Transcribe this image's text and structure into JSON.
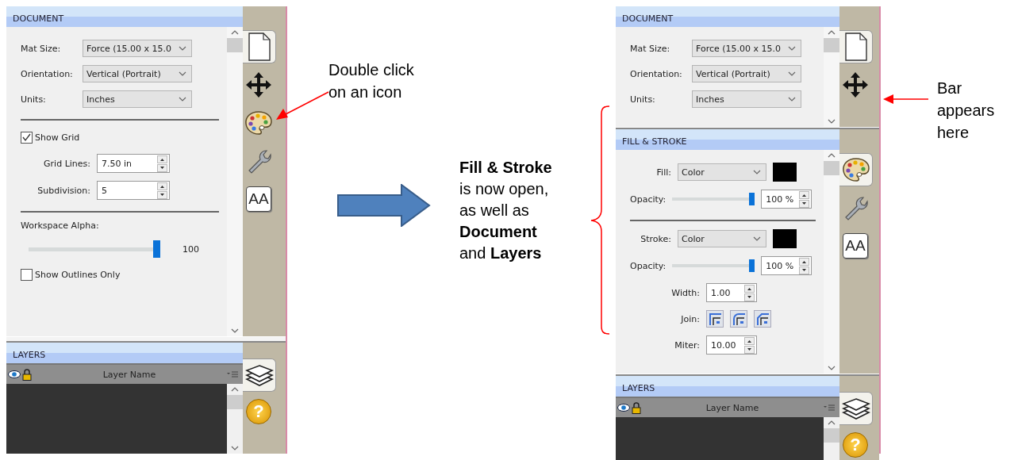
{
  "panels": [
    {
      "sections": [
        {
          "kind": "document",
          "title": "DOCUMENT",
          "tool_tabs": [
            {
              "kind": "document",
              "selected": true
            },
            {
              "kind": "move",
              "selected": false
            },
            {
              "kind": "palette",
              "selected": false
            },
            {
              "kind": "wrench",
              "selected": false
            },
            {
              "kind": "text_size",
              "glyph": "AA",
              "selected": false
            }
          ],
          "groups": [
            [
              {
                "kind": "select",
                "label": "Mat Size:",
                "value": "Force (15.00 x 15.0"
              },
              {
                "kind": "select",
                "label": "Orientation:",
                "value": "Vertical (Portrait)"
              },
              {
                "kind": "select",
                "label": "Units:",
                "value": "Inches"
              }
            ],
            [
              {
                "kind": "check",
                "label": "Show Grid",
                "checked": true
              },
              {
                "kind": "spin",
                "label": "Grid Lines:",
                "value": "7.50 in"
              },
              {
                "kind": "spin",
                "label": "Subdivision:",
                "value": "5"
              }
            ],
            [
              {
                "kind": "slider",
                "label": "Workspace Alpha:",
                "level": 1,
                "reading": "100"
              },
              {
                "kind": "check",
                "label": "Show Outlines Only",
                "checked": false
              }
            ]
          ]
        },
        {
          "kind": "layers",
          "title": "LAYERS",
          "column_header": "Layer Name",
          "tool_tabs": [
            {
              "kind": "layers",
              "selected": true
            },
            {
              "kind": "help",
              "glyph": "?",
              "selected": false
            }
          ]
        }
      ]
    },
    {
      "sections": [
        {
          "kind": "document",
          "title": "DOCUMENT",
          "tool_tabs": [
            {
              "kind": "document",
              "selected": true
            },
            {
              "kind": "move",
              "selected": false
            }
          ],
          "groups": [
            [
              {
                "kind": "select",
                "label": "Mat Size:",
                "value": "Force (15.00 x 15.0"
              },
              {
                "kind": "select",
                "label": "Orientation:",
                "value": "Vertical (Portrait)"
              },
              {
                "kind": "select",
                "label": "Units:",
                "value": "Inches"
              }
            ]
          ]
        },
        {
          "kind": "fill_stroke",
          "title": "FILL & STROKE",
          "tool_tabs": [
            {
              "kind": "palette",
              "selected": true
            },
            {
              "kind": "wrench",
              "selected": false
            },
            {
              "kind": "text_size",
              "glyph": "AA",
              "selected": false
            }
          ],
          "groups": [
            [
              {
                "kind": "select",
                "label": "Fill:",
                "value": "Color",
                "color": "#000000"
              },
              {
                "kind": "slider_spin",
                "label": "Opacity:",
                "level": 1,
                "reading": "100 %"
              }
            ],
            [
              {
                "kind": "select",
                "label": "Stroke:",
                "value": "Color",
                "color": "#000000"
              },
              {
                "kind": "slider_spin",
                "label": "Opacity:",
                "level": 1,
                "reading": "100 %"
              },
              {
                "kind": "spin",
                "label": "Width:",
                "value": "1.00"
              },
              {
                "kind": "joins",
                "label": "Join:",
                "options": [
                  {
                    "kind": "miter"
                  },
                  {
                    "kind": "round"
                  },
                  {
                    "kind": "bevel"
                  }
                ]
              },
              {
                "kind": "spin",
                "label": "Miter:",
                "value": "10.00"
              }
            ]
          ]
        },
        {
          "kind": "layers",
          "title": "LAYERS",
          "column_header": "Layer Name",
          "tool_tabs": [
            {
              "kind": "layers",
              "selected": true
            },
            {
              "kind": "help",
              "glyph": "?",
              "selected": false
            }
          ]
        }
      ]
    }
  ],
  "double_click_note": "Double click on an icon",
  "result_note": "**Fill & Stroke** is now open, as well as **Document** and **Layers**",
  "bar_note": "Bar appears here"
}
